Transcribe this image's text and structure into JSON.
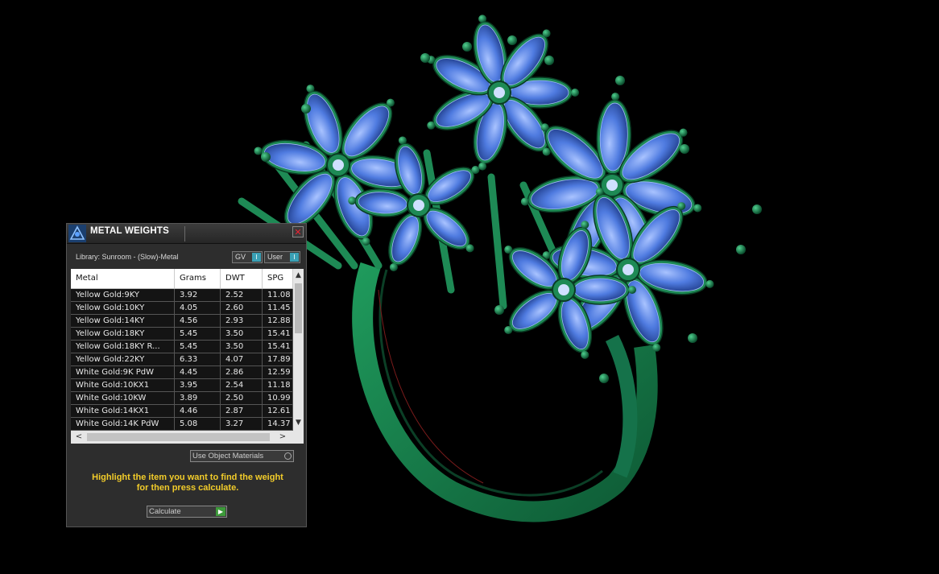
{
  "panel": {
    "title": "METAL WEIGHTS",
    "close_label": "✕",
    "library_label": "Library: Sunroom - (Slow)-Metal",
    "gv_label": "GV",
    "user_label": "User",
    "toggle_glyph": "I"
  },
  "table": {
    "columns": [
      "Metal",
      "Grams",
      "DWT",
      "SPG"
    ],
    "rows": [
      [
        "Yellow Gold:9KY",
        "3.92",
        "2.52",
        "11.08"
      ],
      [
        "Yellow Gold:10KY",
        "4.05",
        "2.60",
        "11.45"
      ],
      [
        "Yellow Gold:14KY",
        "4.56",
        "2.93",
        "12.88"
      ],
      [
        "Yellow Gold:18KY",
        "5.45",
        "3.50",
        "15.41"
      ],
      [
        "Yellow Gold:18KY R...",
        "5.45",
        "3.50",
        "15.41"
      ],
      [
        "Yellow Gold:22KY",
        "6.33",
        "4.07",
        "17.89"
      ],
      [
        "White Gold:9K PdW",
        "4.45",
        "2.86",
        "12.59"
      ],
      [
        "White Gold:10KX1",
        "3.95",
        "2.54",
        "11.18"
      ],
      [
        "White Gold:10KW",
        "3.89",
        "2.50",
        "10.99"
      ],
      [
        "White Gold:14KX1",
        "4.46",
        "2.87",
        "12.61"
      ],
      [
        "White Gold:14K PdW",
        "5.08",
        "3.27",
        "14.37"
      ]
    ],
    "scroll_up": "▲",
    "scroll_down": "▼",
    "scroll_left": "<",
    "scroll_right": ">"
  },
  "use_object_materials_label": "Use Object Materials",
  "help_text_line1": "Highlight the item you want to find the weight",
  "help_text_line2": "for then press calculate.",
  "calculate_label": "Calculate",
  "calculate_glyph": "▶",
  "colors": {
    "metal_green": "#1e8a55",
    "gem_blue": "#4d78d8",
    "help_yellow": "#f2cc2a"
  }
}
